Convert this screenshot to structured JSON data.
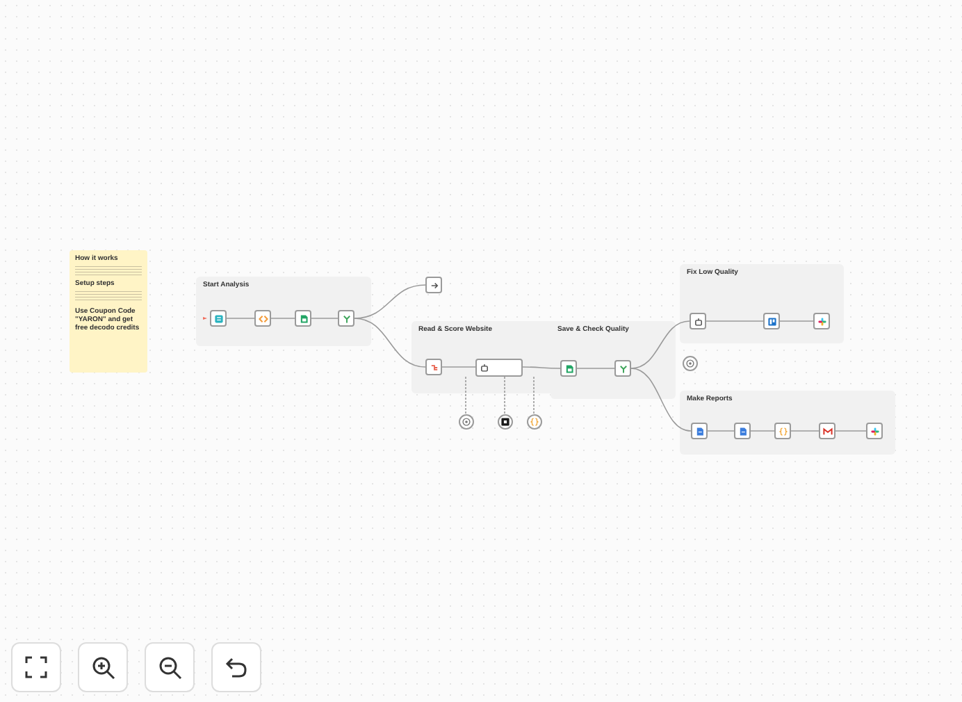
{
  "sticky_note": {
    "headings": [
      "How it works",
      "Setup steps"
    ],
    "coupon": "Use Coupon Code \"YARON\" and get free decodo credits"
  },
  "groups": [
    {
      "title": "Start Analysis"
    },
    {
      "title": "Read & Score Website"
    },
    {
      "title": "Save & Check Quality"
    },
    {
      "title": "Fix Low Quality"
    },
    {
      "title": "Make Reports"
    }
  ],
  "nodes": [
    {
      "kind": "square"
    },
    {
      "kind": "square"
    },
    {
      "kind": "square"
    },
    {
      "kind": "square"
    },
    {
      "kind": "square"
    },
    {
      "kind": "square"
    },
    {
      "kind": "wide"
    },
    {
      "kind": "circle"
    },
    {
      "kind": "circle"
    },
    {
      "kind": "circle"
    },
    {
      "kind": "square"
    },
    {
      "kind": "square"
    },
    {
      "kind": "square"
    },
    {
      "kind": "square"
    },
    {
      "kind": "square"
    },
    {
      "kind": "circle"
    },
    {
      "kind": "square"
    },
    {
      "kind": "square"
    },
    {
      "kind": "square"
    },
    {
      "kind": "square"
    },
    {
      "kind": "square"
    }
  ]
}
